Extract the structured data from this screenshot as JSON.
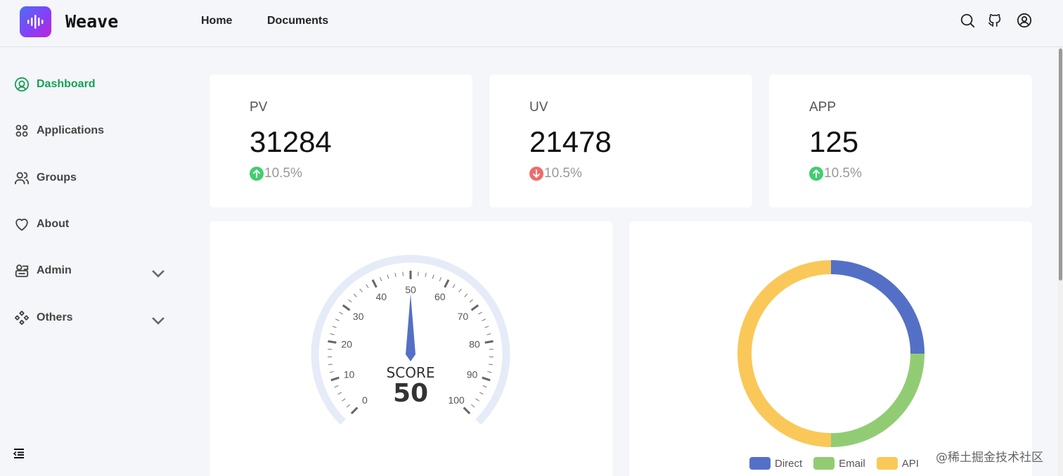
{
  "header": {
    "brand": "Weave",
    "nav": [
      {
        "label": "Home"
      },
      {
        "label": "Documents"
      }
    ]
  },
  "sidebar": {
    "items": [
      {
        "label": "Dashboard",
        "icon": "dashboard-icon",
        "active": true
      },
      {
        "label": "Applications",
        "icon": "apps-grid-icon"
      },
      {
        "label": "Groups",
        "icon": "users-icon"
      },
      {
        "label": "About",
        "icon": "heart-icon"
      },
      {
        "label": "Admin",
        "icon": "admin-icon",
        "expandable": true
      },
      {
        "label": "Others",
        "icon": "diamond-grid-icon",
        "expandable": true
      }
    ]
  },
  "stats": [
    {
      "label": "PV",
      "value": "31284",
      "trend": "up",
      "percent": "10.5%"
    },
    {
      "label": "UV",
      "value": "21478",
      "trend": "down",
      "percent": "10.5%"
    },
    {
      "label": "APP",
      "value": "125",
      "trend": "up",
      "percent": "10.5%"
    }
  ],
  "colors": {
    "accent": "#18a058",
    "up": "#3ecf6e",
    "down": "#f06b6b",
    "gauge_pointer": "#5470c6",
    "gauge_track": "#e6ebf8"
  },
  "chart_data": [
    {
      "type": "gauge",
      "min": 0,
      "max": 100,
      "value": 50,
      "label": "SCORE",
      "tick_labels": [
        "0",
        "10",
        "20",
        "30",
        "40",
        "50",
        "60",
        "70",
        "80",
        "90",
        "100"
      ]
    },
    {
      "type": "pie",
      "donut": true,
      "categories": [
        "Direct",
        "Email",
        "API"
      ],
      "values": [
        25,
        25,
        50
      ],
      "colors": [
        "#5470c6",
        "#91cc75",
        "#fac858"
      ],
      "legend_position": "bottom"
    }
  ],
  "watermark": "@稀土掘金技术社区"
}
